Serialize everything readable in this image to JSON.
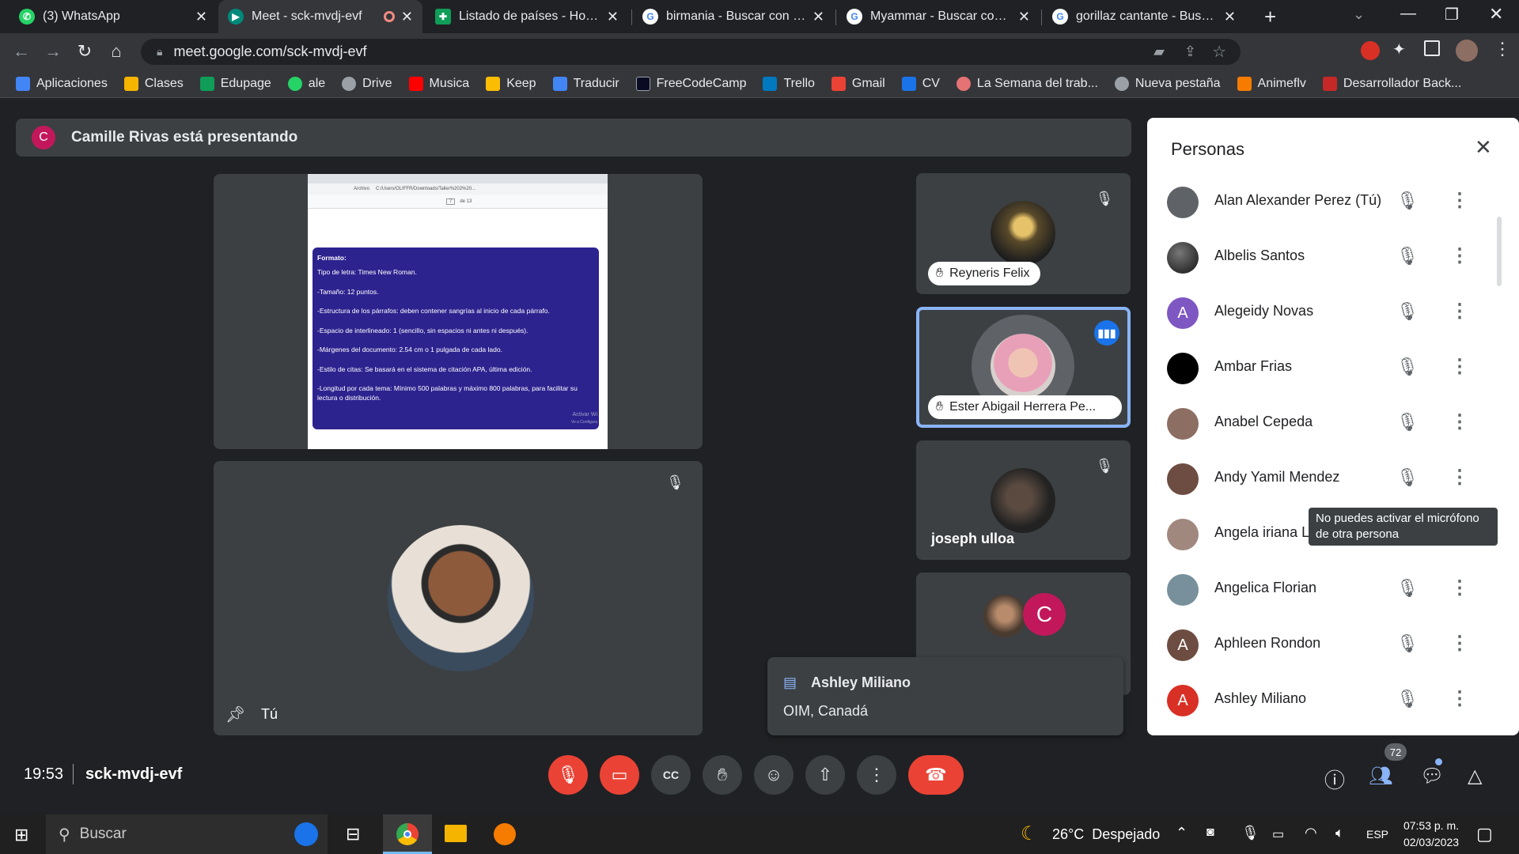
{
  "tabs": [
    {
      "title": "(3) WhatsApp",
      "fav": "whatsapp-icon",
      "color": "#25d366"
    },
    {
      "title": "Meet - sck-mvdj-evf",
      "fav": "meet-icon",
      "color": "#00897b",
      "active": true
    },
    {
      "title": "Listado de países - Hojas de",
      "fav": "sheets-icon",
      "color": "#0f9d58"
    },
    {
      "title": "birmania - Buscar con Goog",
      "fav": "google-icon",
      "color": "#4285f4"
    },
    {
      "title": "Myammar - Buscar con Goo",
      "fav": "google-icon",
      "color": "#4285f4"
    },
    {
      "title": "gorillaz cantante - Buscar c",
      "fav": "google-icon",
      "color": "#4285f4"
    }
  ],
  "address": {
    "url": "meet.google.com/sck-mvdj-evf"
  },
  "bookmarks": [
    {
      "label": "Aplicaciones",
      "color": "#4285f4"
    },
    {
      "label": "Clases",
      "color": "#f4b400"
    },
    {
      "label": "Edupage",
      "color": "#0f9d58"
    },
    {
      "label": "ale",
      "color": "#25d366"
    },
    {
      "label": "Drive",
      "color": "#9aa0a6"
    },
    {
      "label": "Musica",
      "color": "#ff0000"
    },
    {
      "label": "Keep",
      "color": "#fbbc04"
    },
    {
      "label": "Traducir",
      "color": "#4285f4"
    },
    {
      "label": "FreeCodeCamp",
      "color": "#0a0a23"
    },
    {
      "label": "Trello",
      "color": "#0079bf"
    },
    {
      "label": "Gmail",
      "color": "#ea4335"
    },
    {
      "label": "CV",
      "color": "#1a73e8"
    },
    {
      "label": "La Semana del trab...",
      "color": "#e57373"
    },
    {
      "label": "Nueva pestaña",
      "color": "#9aa0a6"
    },
    {
      "label": "Animeflv",
      "color": "#f57c00"
    },
    {
      "label": "Desarrollador Back...",
      "color": "#c62828"
    }
  ],
  "meet": {
    "presenting_initial": "C",
    "presenting_text": "Camille Rivas está presentando",
    "self_label": "Tú",
    "tiles": [
      {
        "name": "Reyneris Felix"
      },
      {
        "name": "Ester Abigail Herrera Pe..."
      },
      {
        "name": "joseph ulloa"
      }
    ],
    "group_initial": "C",
    "notification": {
      "name": "Ashley Miliano",
      "text": "OIM, Canadá"
    },
    "time": "19:53",
    "code": "sck-mvdj-evf",
    "people_count": "72"
  },
  "shared_doc": {
    "heading": "Formato:",
    "lines": [
      "Tipo de letra: Times New Roman.",
      "-Tamaño: 12 puntos.",
      "-Estructura de los párrafos: deben contener sangrías al inicio de cada párrafo.",
      "-Espacio de interlineado: 1 (sencillo, sin espacios ni antes ni después).",
      "-Márgenes del documento: 2.54 cm o 1 pulgada de cada lado.",
      "-Estilo de citas: Se basará en el sistema de citación APA, última edición.",
      "-Longitud por cada tema: Mínimo 500 palabras y máximo 800 palabras, para facilitar su lectura o distribución."
    ],
    "path": "C:/Users/OLIFFR/Downloads/Taller%202%20...",
    "page": "7",
    "pages": "de 13",
    "file_label": "Archivo",
    "watermark": "Activar Wi",
    "watermark2": "Ve a Configura"
  },
  "people": {
    "title": "Personas",
    "list": [
      {
        "name": "Alan Alexander Perez (Tú)",
        "color": "#5f6368"
      },
      {
        "name": "Albelis Santos",
        "color": "#1a1a1a"
      },
      {
        "name": "Alegeidy Novas",
        "color": "#7e57c2",
        "initial": "A"
      },
      {
        "name": "Ambar Frias",
        "color": "#000000"
      },
      {
        "name": "Anabel Cepeda",
        "color": "#8d6e63"
      },
      {
        "name": "Andy Yamil Mendez",
        "color": "#6d4c41"
      },
      {
        "name": "Angela iriana Lo",
        "color": "#a1887f"
      },
      {
        "name": "Angelica Florian",
        "color": "#78909c"
      },
      {
        "name": "Aphleen Rondon",
        "color": "#6d4c41",
        "initial": "A"
      },
      {
        "name": "Ashley Miliano",
        "color": "#d93025",
        "initial": "A"
      }
    ],
    "tooltip": "No puedes activar el micrófono de otra persona"
  },
  "taskbar": {
    "search": "Buscar",
    "weather": "26°C  Despejado",
    "lang": "ESP",
    "time": "07:53 p. m.",
    "date": "02/03/2023"
  }
}
